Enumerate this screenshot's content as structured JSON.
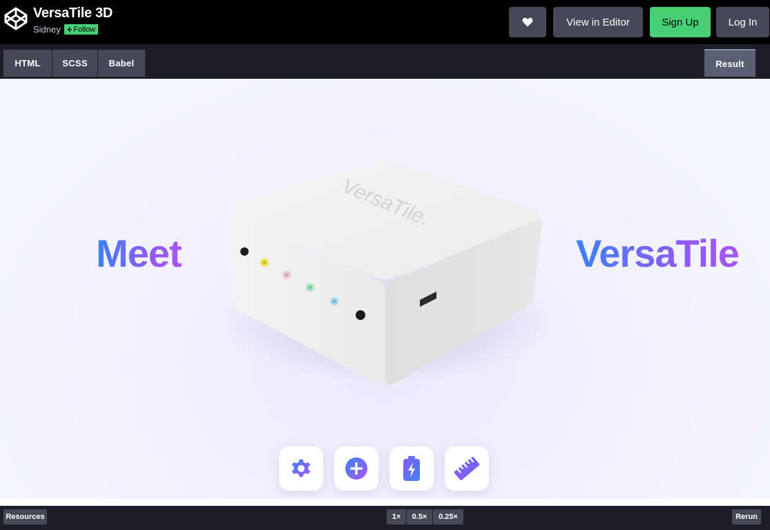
{
  "header": {
    "title": "VersaTile 3D",
    "author": "Sidney",
    "follow_label": "Follow",
    "heart_icon": "heart-icon",
    "view_editor_label": "View in Editor",
    "signup_label": "Sign Up",
    "login_label": "Log In",
    "accent_green": "#47cf73"
  },
  "tabs": {
    "html": "HTML",
    "scss": "SCSS",
    "babel": "Babel",
    "result": "Result"
  },
  "preview": {
    "left_word": "Meet",
    "right_word": "VersaTile",
    "device_brand": "VersaTile.",
    "tools": [
      {
        "icon": "gear-icon"
      },
      {
        "icon": "plus-circle-icon"
      },
      {
        "icon": "battery-charging-icon"
      },
      {
        "icon": "ruler-icon"
      }
    ],
    "gradient_start": "#3b82f6",
    "gradient_end": "#a855f7"
  },
  "footer": {
    "resources_label": "Resources",
    "zoom_1": "1×",
    "zoom_05": "0.5×",
    "zoom_025": "0.25×",
    "rerun_label": "Rerun"
  }
}
